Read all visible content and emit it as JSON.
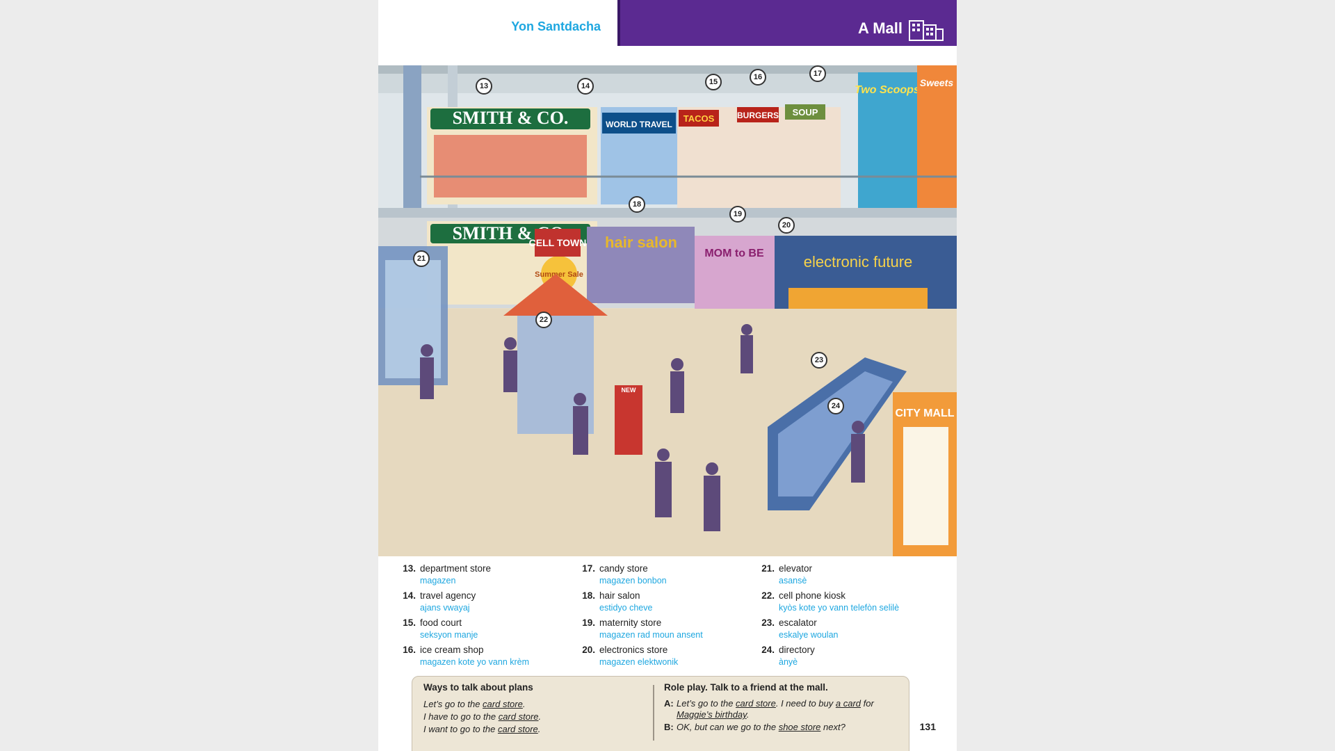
{
  "header": {
    "author": "Yon Santdacha",
    "title": "A Mall",
    "icon": "mall-building-icon"
  },
  "illustration": {
    "signs": {
      "department_store": "SMITH & CO.",
      "travel": "WORLD TRAVEL",
      "tacos": "TACOS",
      "burgers": "BURGERS",
      "soup": "SOUP",
      "ice_cream": "Two Scoops",
      "candy": "Sweets",
      "hair": "hair salon",
      "maternity": "MOM to BE",
      "electronics": "electronic future",
      "kiosk": "CELL TOWN",
      "directory": "CITY MALL",
      "sale": "Summer Sale",
      "new": "NEW"
    },
    "labels": [
      "13",
      "14",
      "15",
      "16",
      "17",
      "18",
      "19",
      "20",
      "21",
      "22",
      "23",
      "24"
    ]
  },
  "vocab": {
    "col1": [
      {
        "num": "13.",
        "en": "department store",
        "tr": "magazen"
      },
      {
        "num": "14.",
        "en": "travel agency",
        "tr": "ajans vwayaj"
      },
      {
        "num": "15.",
        "en": "food court",
        "tr": "seksyon manje"
      },
      {
        "num": "16.",
        "en": "ice cream shop",
        "tr": "magazen kote yo vann krèm"
      }
    ],
    "col2": [
      {
        "num": "17.",
        "en": "candy store",
        "tr": "magazen bonbon"
      },
      {
        "num": "18.",
        "en": "hair salon",
        "tr": "estidyo cheve"
      },
      {
        "num": "19.",
        "en": "maternity store",
        "tr": "magazen rad moun ansent"
      },
      {
        "num": "20.",
        "en": "electronics store",
        "tr": "magazen elektwonik"
      }
    ],
    "col3": [
      {
        "num": "21.",
        "en": "elevator",
        "tr": "asansè"
      },
      {
        "num": "22.",
        "en": "cell phone kiosk",
        "tr": "kyòs kote yo vann telefòn selilè"
      },
      {
        "num": "23.",
        "en": "escalator",
        "tr": "eskalye woulan"
      },
      {
        "num": "24.",
        "en": "directory",
        "tr": "ànyè"
      }
    ]
  },
  "talk": {
    "left_heading": "Ways to talk about plans",
    "lines": [
      {
        "pre": "Let’s go to the ",
        "u": "card store",
        "post": "."
      },
      {
        "pre": "I have to go to the ",
        "u": "card store",
        "post": "."
      },
      {
        "pre": "I want to go to the ",
        "u": "card store",
        "post": "."
      }
    ],
    "right_heading": "Role play. Talk to a friend at the mall.",
    "a_label": "A:",
    "a_pre": "Let’s go to the ",
    "a_u1": "card store",
    "a_mid": ". I need to buy ",
    "a_u2": "a card",
    "a_post": " for",
    "a_u3": "Maggie’s birthday",
    "a_end": ".",
    "b_label": "B:",
    "b_pre": "OK, but can we go to the ",
    "b_u": "shoe store",
    "b_post": " next?"
  },
  "page_number": "131"
}
